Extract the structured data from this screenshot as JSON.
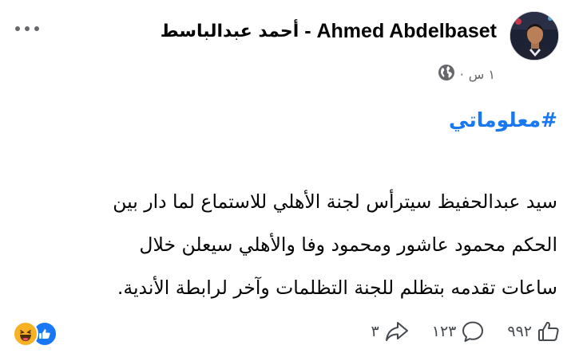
{
  "post": {
    "author_latin": "Ahmed Abdelbaset",
    "author_separator": " - ",
    "author_arabic": "أحمد عبدالباسط",
    "time": "١ س",
    "meta_separator": "·",
    "hashtag": "#معلوماتي",
    "text": "سيد عبدالحفيظ سيترأس لجنة الأهلي للاستماع لما دار بين\nالحكم محمود عاشور ومحمود وفا والأهلي سيعلن خلال\nساعات تقدمه بتظلم للجنة التظلمات وآخر لرابطة الأندية."
  },
  "stats": {
    "likes": "٩٩٢",
    "comments": "١٢٣",
    "shares": "٣"
  },
  "icons": {
    "more": "more-horizontal-icon",
    "privacy": "globe-icon",
    "like": "thumbs-up-icon",
    "comment": "comment-bubble-icon",
    "share": "share-arrow-icon",
    "reactions": [
      "haha-reaction-icon",
      "like-reaction-icon"
    ]
  },
  "colors": {
    "accent": "#1877f2",
    "secondary_text": "#65676b",
    "haha": "#f7b125"
  }
}
